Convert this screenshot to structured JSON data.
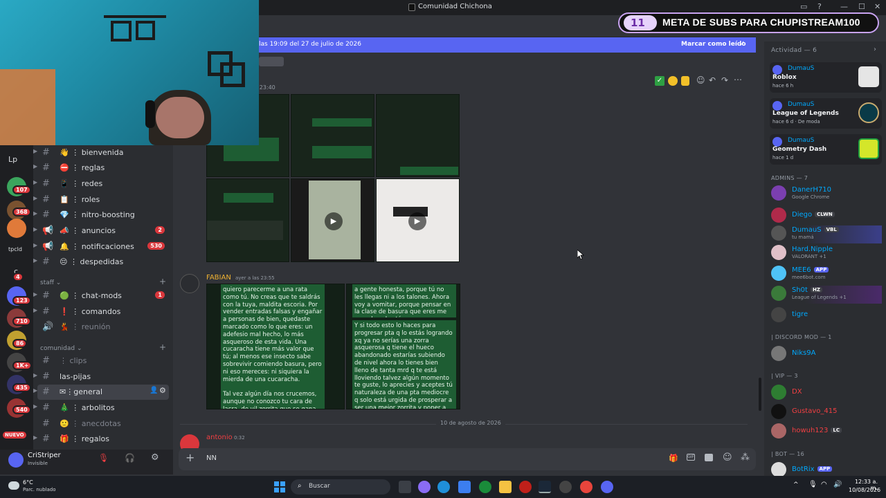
{
  "window": {
    "title": "Comunidad Chichona",
    "controls": [
      "—",
      "☐",
      "✕"
    ]
  },
  "stream_banner": {
    "count": "11",
    "text": "META DE SUBS PARA CHUPISTREAM100"
  },
  "unread": {
    "text": "las 19:09 del 27 de julio de 2026",
    "mark_read": "Marcar como leído"
  },
  "servers": [
    {
      "label": "Lp",
      "badge": ""
    },
    {
      "label": "",
      "badge": "107"
    },
    {
      "label": "",
      "badge": "368"
    },
    {
      "label": "",
      "badge": ""
    },
    {
      "label": "tpcld",
      "badge": ""
    },
    {
      "label": "c",
      "badge": "4"
    },
    {
      "label": "",
      "badge": "123"
    },
    {
      "label": "",
      "badge": "710"
    },
    {
      "label": "",
      "badge": "86"
    },
    {
      "label": "",
      "badge": "1K+"
    },
    {
      "label": "",
      "badge": "435"
    },
    {
      "label": "",
      "badge": "540"
    },
    {
      "label": "NUEVO",
      "badge": ""
    }
  ],
  "channels": [
    {
      "name": "bienvenida",
      "emoji": "👋",
      "badge": ""
    },
    {
      "name": "reglas",
      "emoji": "⛔",
      "badge": ""
    },
    {
      "name": "redes",
      "emoji": "📱",
      "badge": ""
    },
    {
      "name": "roles",
      "emoji": "📋",
      "badge": ""
    },
    {
      "name": "nitro-boosting",
      "emoji": "💎",
      "badge": ""
    },
    {
      "name": "anuncios",
      "emoji": "📣",
      "badge": "2"
    },
    {
      "name": "notificaciones",
      "emoji": "🔔",
      "badge": "530"
    },
    {
      "name": "despedidas",
      "emoji": "😔",
      "badge": ""
    }
  ],
  "category_staff": "staff",
  "staff_channels": [
    {
      "name": "chat-mods",
      "emoji": "🟢",
      "badge": "1"
    },
    {
      "name": "comandos",
      "emoji": "❗",
      "badge": ""
    },
    {
      "name": "reunión",
      "emoji": "💃",
      "badge": ""
    }
  ],
  "category_comunidad": "comunidad",
  "comunidad_channels": [
    {
      "name": "clips",
      "badge": ""
    },
    {
      "name": "las-pijas",
      "badge": ""
    },
    {
      "name": "general",
      "badge": ""
    },
    {
      "name": "arbolitos",
      "badge": ""
    },
    {
      "name": "anecdotas",
      "badge": ""
    },
    {
      "name": "regalos",
      "badge": ""
    }
  ],
  "user": {
    "name": "CriStriper",
    "status": "Invisible"
  },
  "messages": {
    "first_time": "s 23:40",
    "fabian": {
      "author": "FABIAN",
      "time": "ayer a las 23:55",
      "left_text": "quiero parecerme a una rata como tú. No creas que te saldrás con la tuya, maldita escoria. Por vender entradas falsas y engañar a personas de bien, quedaste marcado como lo que eres: un adefesio mal hecho, lo más asqueroso de esta vida. Una cucaracha tiene más valor que tú; al menos ese insecto sabe sobrevivir comiendo basura, pero ni eso mereces: ni siquiera la mierda de una cucaracha.\n\nTal vez algún día nos crucemos, aunque no conozco tu cara de lacra, de vil zorrita que se gana la vida estafando. Pero estoy segura de que sentiré el olor a podredumbre que",
      "right_text_top": "a gente honesta, porque tú no les llegas ni a los talones. Ahora voy a vomitar, porque pensar en la clase de basura que eres me revuelve el estómago.",
      "right_text": "Y si todo esto lo haces para progresar pta q lo estás logrando xq ya no serías una zorra asquerosa q tiene el hueco abandonado estarías subiendo de nivel ahora lo tienes bien lleno de tanta mrd q te está lloviendo talvez algún momento te guste, lo aprecies y aceptes tú naturaleza de una pta mediocre q solo está urgida de prosperar a ser una mejor zorrita y poner a trabajar sus dos huecos."
    },
    "divider": "10 de agosto de 2026",
    "antonio": {
      "author": "antonio",
      "time": "0:32"
    }
  },
  "composer": {
    "value": "NN"
  },
  "members": {
    "activity_header": "Actividad — 6",
    "activities": [
      {
        "name": "DumauS",
        "game": "Roblox",
        "time": "hace 6 h"
      },
      {
        "name": "DumauS",
        "game": "League of Legends",
        "time": "hace 6 d · De moda"
      },
      {
        "name": "DumauS",
        "game": "Geometry Dash",
        "time": "hace 1 d"
      }
    ],
    "admins_header": "ADMINS — 7",
    "admins": [
      {
        "name": "DanerH710",
        "sub": "Google Chrome",
        "tag": "",
        "color": "#00a8fc"
      },
      {
        "name": "Diego",
        "sub": "",
        "tag": "CLWN",
        "color": "#00a8fc"
      },
      {
        "name": "DumauS",
        "sub": "tu mamá",
        "tag": "VBL",
        "color": "#00a8fc"
      },
      {
        "name": "Hard.Nipple",
        "sub": "VALORANT +1",
        "tag": "",
        "color": "#00a8fc"
      },
      {
        "name": "MEE6",
        "sub": "mee6bot.com",
        "tag": "APP",
        "color": "#00a8fc"
      },
      {
        "name": "Sh0t",
        "sub": "League of Legends +1",
        "tag": "HZ",
        "color": "#00a8fc"
      },
      {
        "name": "tigre",
        "sub": "",
        "tag": "",
        "color": "#00a8fc"
      }
    ],
    "discord_mod_header": "| DISCORD MOD — 1",
    "mods": [
      {
        "name": "Niks9A",
        "color": "#00a8fc"
      }
    ],
    "vip_header": "| VIP — 3",
    "vips": [
      {
        "name": "DX",
        "tag": "",
        "color": "#f23f42"
      },
      {
        "name": "Gustavo_415",
        "tag": "",
        "color": "#f23f42"
      },
      {
        "name": "howuh123",
        "tag": "LC",
        "color": "#f23f42"
      }
    ],
    "bot_header": "| BOT — 16",
    "bots": [
      {
        "name": "BotRix",
        "tag": "APP",
        "color": "#00a8fc"
      }
    ]
  },
  "taskbar": {
    "weather_temp": "6°C",
    "weather_desc": "Parc. nublado",
    "search": "Buscar",
    "time": "12:33 a. m.",
    "date": "10/08/2026"
  }
}
